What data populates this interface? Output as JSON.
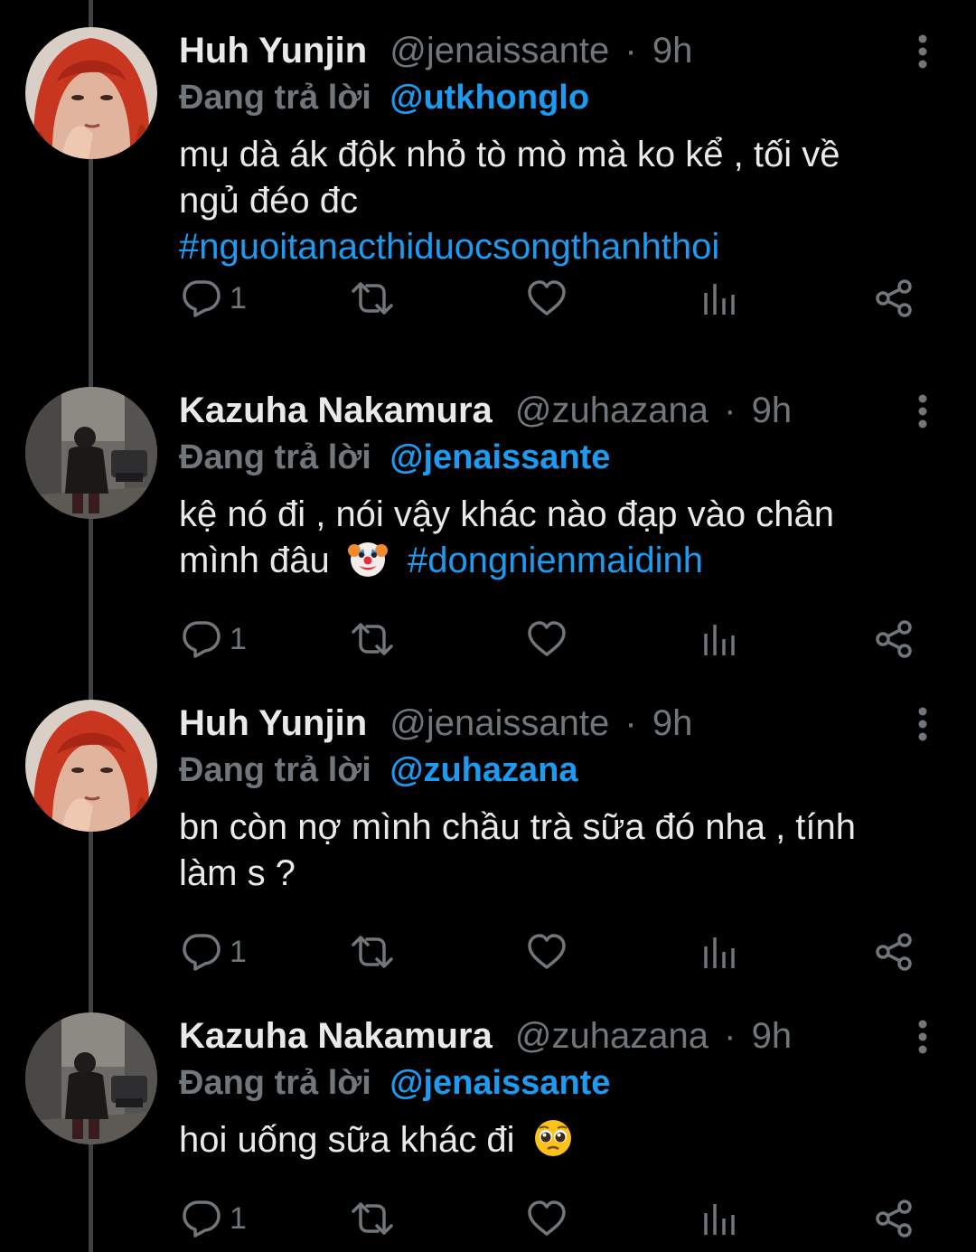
{
  "colors": {
    "background": "#000000",
    "text_primary": "#e7e9ea",
    "text_secondary": "#71767b",
    "accent": "#1d9bf0",
    "thread_line": "#3e4144"
  },
  "icons": {
    "reply": "reply-icon",
    "retweet": "retweet-icon",
    "like": "heart-icon",
    "views": "analytics-icon",
    "share": "share-icon",
    "more": "more-vertical-icon"
  },
  "tweets": [
    {
      "name": "Huh Yunjin",
      "handle": "@jenaissante",
      "separator": "·",
      "time": "9h",
      "reply_prefix": "Đang trả lời",
      "reply_to": "@utkhonglo",
      "line1": "mụ dà ák độk nhỏ tò mò mà ko kể , tối về",
      "line2": "ngủ đéo đc",
      "hashtag": "#nguoitanacthiduocsongthanhthoi",
      "reply_count": "1"
    },
    {
      "name": "Kazuha Nakamura",
      "handle": "@zuhazana",
      "separator": "·",
      "time": "9h",
      "reply_prefix": "Đang trả lời",
      "reply_to": "@jenaissante",
      "line1": "kệ nó đi , nói vậy khác nào đạp vào chân",
      "line2": "mình đâu",
      "emoji": "clown-face",
      "hashtag": "#dongnienmaidinh",
      "reply_count": "1"
    },
    {
      "name": "Huh Yunjin",
      "handle": "@jenaissante",
      "separator": "·",
      "time": "9h",
      "reply_prefix": "Đang trả lời",
      "reply_to": "@zuhazana",
      "line1": "bn còn nợ mình chầu trà sữa đó nha , tính",
      "line2": "làm s ?",
      "reply_count": "1"
    },
    {
      "name": "Kazuha Nakamura",
      "handle": "@zuhazana",
      "separator": "·",
      "time": "9h",
      "reply_prefix": "Đang trả lời",
      "reply_to": "@jenaissante",
      "line1": "hoi uống sữa khác đi",
      "emoji": "pleading-face",
      "reply_count": "1"
    }
  ]
}
